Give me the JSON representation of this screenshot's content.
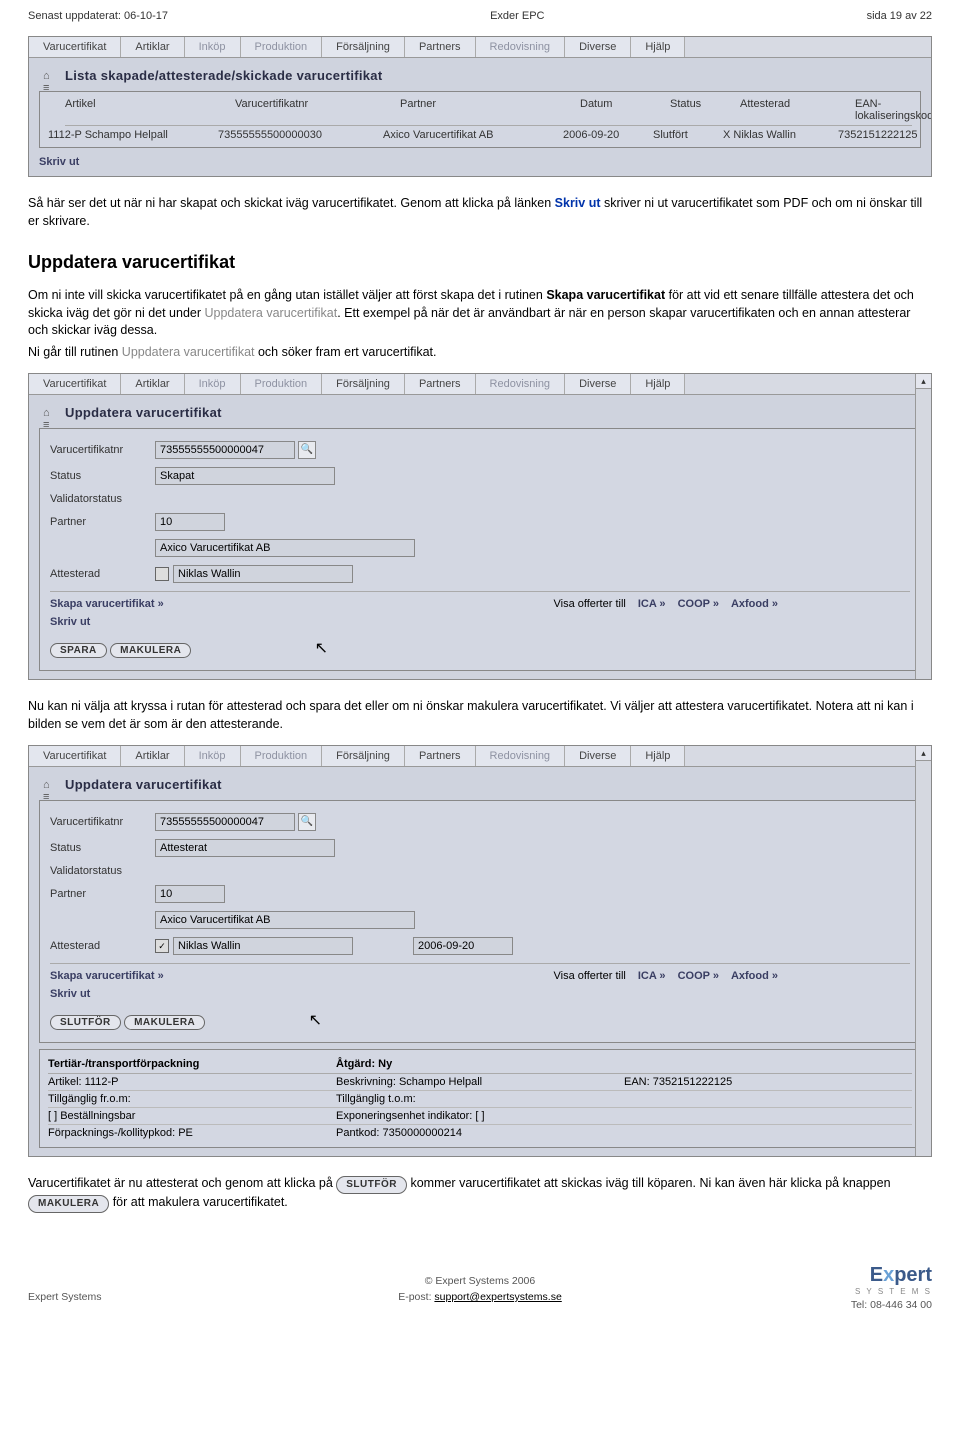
{
  "header": {
    "left": "Senast uppdaterat: 06-10-17",
    "center": "Exder EPC",
    "right": "sida 19 av 22"
  },
  "menu": {
    "m1": "Varucertifikat",
    "m2": "Artiklar",
    "m3": "Inköp",
    "m4": "Produktion",
    "m5": "Försäljning",
    "m6": "Partners",
    "m7": "Redovisning",
    "m8": "Diverse",
    "m9": "Hjälp"
  },
  "win1": {
    "title": "Lista skapade/attesterade/skickade varucertifikat",
    "th": {
      "art": "Artikel",
      "vnr": "Varucertifikatnr",
      "ptn": "Partner",
      "dat": "Datum",
      "sta": "Status",
      "att": "Attesterad",
      "ean": "EAN-lokaliseringskod"
    },
    "row": {
      "art": "1112-P  Schampo Helpall",
      "vnr": "73555555500000030",
      "ptn": "Axico Varucertifikat AB",
      "dat": "2006-09-20",
      "sta": "Slutfört",
      "att": "X Niklas Wallin",
      "ean": "7352151222125"
    },
    "skriv": "Skriv ut"
  },
  "p1a": "Så här ser det ut när ni har skapat och skickat iväg varucertifikatet. Genom att klicka på länken ",
  "p1b": "Skriv ut",
  "p1c": " skriver ni ut varucertifikatet som PDF och om ni önskar till er skrivare.",
  "h3": "Uppdatera varucertifikat",
  "p2a": "Om ni inte vill skicka varucertifikatet på en gång utan istället väljer att först skapa det i rutinen ",
  "p2b": "Skapa varucertifikat",
  "p2c": " för att vid ett senare tillfälle attestera det och skicka iväg det gör ni det under ",
  "p2d": "Uppdatera varucertifikat",
  "p2e": ". Ett exempel på när det är användbart är när en person skapar varucertifikaten och en annan attesterar och skickar iväg dessa.",
  "p3a": "Ni går till rutinen ",
  "p3b": "Uppdatera varucertifikat",
  "p3c": " och söker fram ert varucertifikat.",
  "win2": {
    "title": "Uppdatera varucertifikat",
    "lbl": {
      "vnr": "Varucertifikatnr",
      "sta": "Status",
      "val": "Validatorstatus",
      "ptn": "Partner",
      "att": "Attesterad"
    },
    "val": {
      "vnr": "73555555500000047",
      "sta": "Skapat",
      "ptn": "10",
      "ptn2": "Axico Varucertifikat AB",
      "att": "Niklas Wallin"
    },
    "links": {
      "skapa": "Skapa varucertifikat »",
      "visa": "Visa offerter till",
      "ica": "ICA »",
      "coop": "COOP »",
      "ax": "Axfood »",
      "skriv": "Skriv ut"
    },
    "btn": {
      "spara": "SPARA",
      "mak": "MAKULERA"
    }
  },
  "p4": "Nu kan ni välja att kryssa i rutan för attesterad och spara det eller om ni önskar makulera varucertifikatet. Vi väljer att attestera varucertifikatet. Notera att ni kan i bilden se vem det är som är den attesterande.",
  "win3": {
    "title": "Uppdatera varucertifikat",
    "val": {
      "vnr": "73555555500000047",
      "sta": "Attesterat",
      "ptn": "10",
      "ptn2": "Axico Varucertifikat AB",
      "att": "Niklas Wallin",
      "dat": "2006-09-20"
    },
    "btn": {
      "slut": "SLUTFÖR",
      "mak": "MAKULERA"
    },
    "sub": {
      "h1": "Tertiär-/transportförpackning",
      "h2": "Åtgärd: Ny",
      "r1a": "Artikel: 1112-P",
      "r1b": "Beskrivning: Schampo Helpall",
      "r1c": "EAN: 7352151222125",
      "r2a": "Tillgänglig fr.o.m:",
      "r2b": "Tillgänglig t.o.m:",
      "r3a": "[  ] Beställningsbar",
      "r3b": "Exponeringsenhet indikator: [  ]",
      "r4a": "Förpacknings-/kollitypkod: PE",
      "r4b": "Pantkod: 7350000000214"
    }
  },
  "p5a": "Varucertifikatet är nu attesterat och genom att klicka på ",
  "p5btn1": "SLUTFÖR",
  "p5b": " kommer varucertifikatet att skickas iväg till köparen. Ni kan även här klicka på knappen ",
  "p5btn2": "MAKULERA",
  "p5c": " för att makulera varucertifikatet.",
  "footer": {
    "c": "© Expert Systems 2006",
    "left": "Expert Systems",
    "mid1": "E-post: ",
    "mid2": "support@expertsystems.se",
    "right": "Tel: 08-446 34 00"
  }
}
